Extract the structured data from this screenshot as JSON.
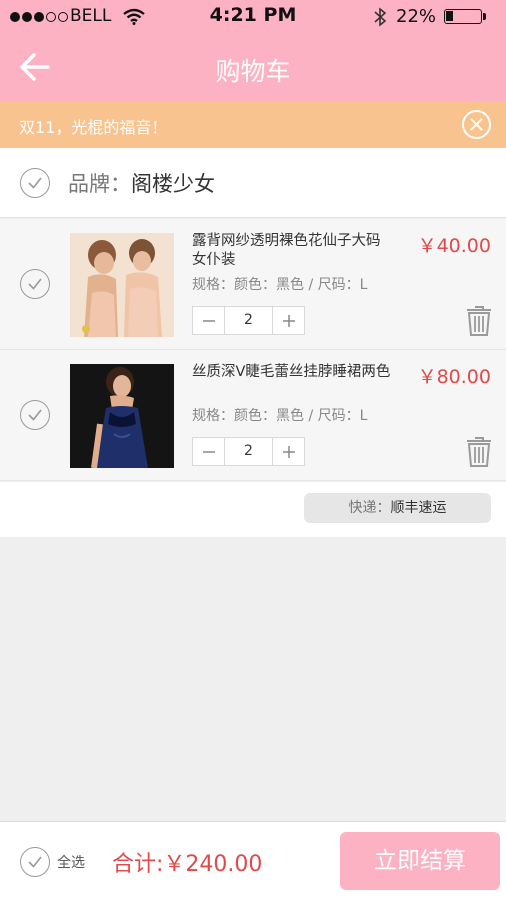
{
  "status_bar": {
    "carrier": "BELL",
    "time": "4:21 PM",
    "battery": "22%",
    "battery_level": 0.22
  },
  "header": {
    "title": "购物车",
    "back_icon": "arrow-left-icon"
  },
  "promo": {
    "text": "双11，光棍的福音！",
    "close_icon": "close-circle-icon"
  },
  "store": {
    "label": "品牌：",
    "name": "阁楼少女"
  },
  "items": [
    {
      "name": "露背网纱透明裸色花仙子大码女仆装",
      "spec": "规格：颜色：黑色 / 尺码：L",
      "price": "￥40.00",
      "quantity": "2"
    },
    {
      "name": "丝质深V睫毛蕾丝挂脖睡裙两色",
      "spec": "规格：颜色：黑色 / 尺码：L",
      "price": "￥80.00",
      "quantity": "2"
    }
  ],
  "shipping": {
    "label": "快递：",
    "value": "顺丰速运"
  },
  "footer": {
    "select_all": "全选",
    "total": "合计:￥240.00",
    "checkout": "立即结算"
  },
  "colors": {
    "header": "#fdb2c4",
    "promo": "#f8c38e",
    "price": "#e04a4a"
  }
}
